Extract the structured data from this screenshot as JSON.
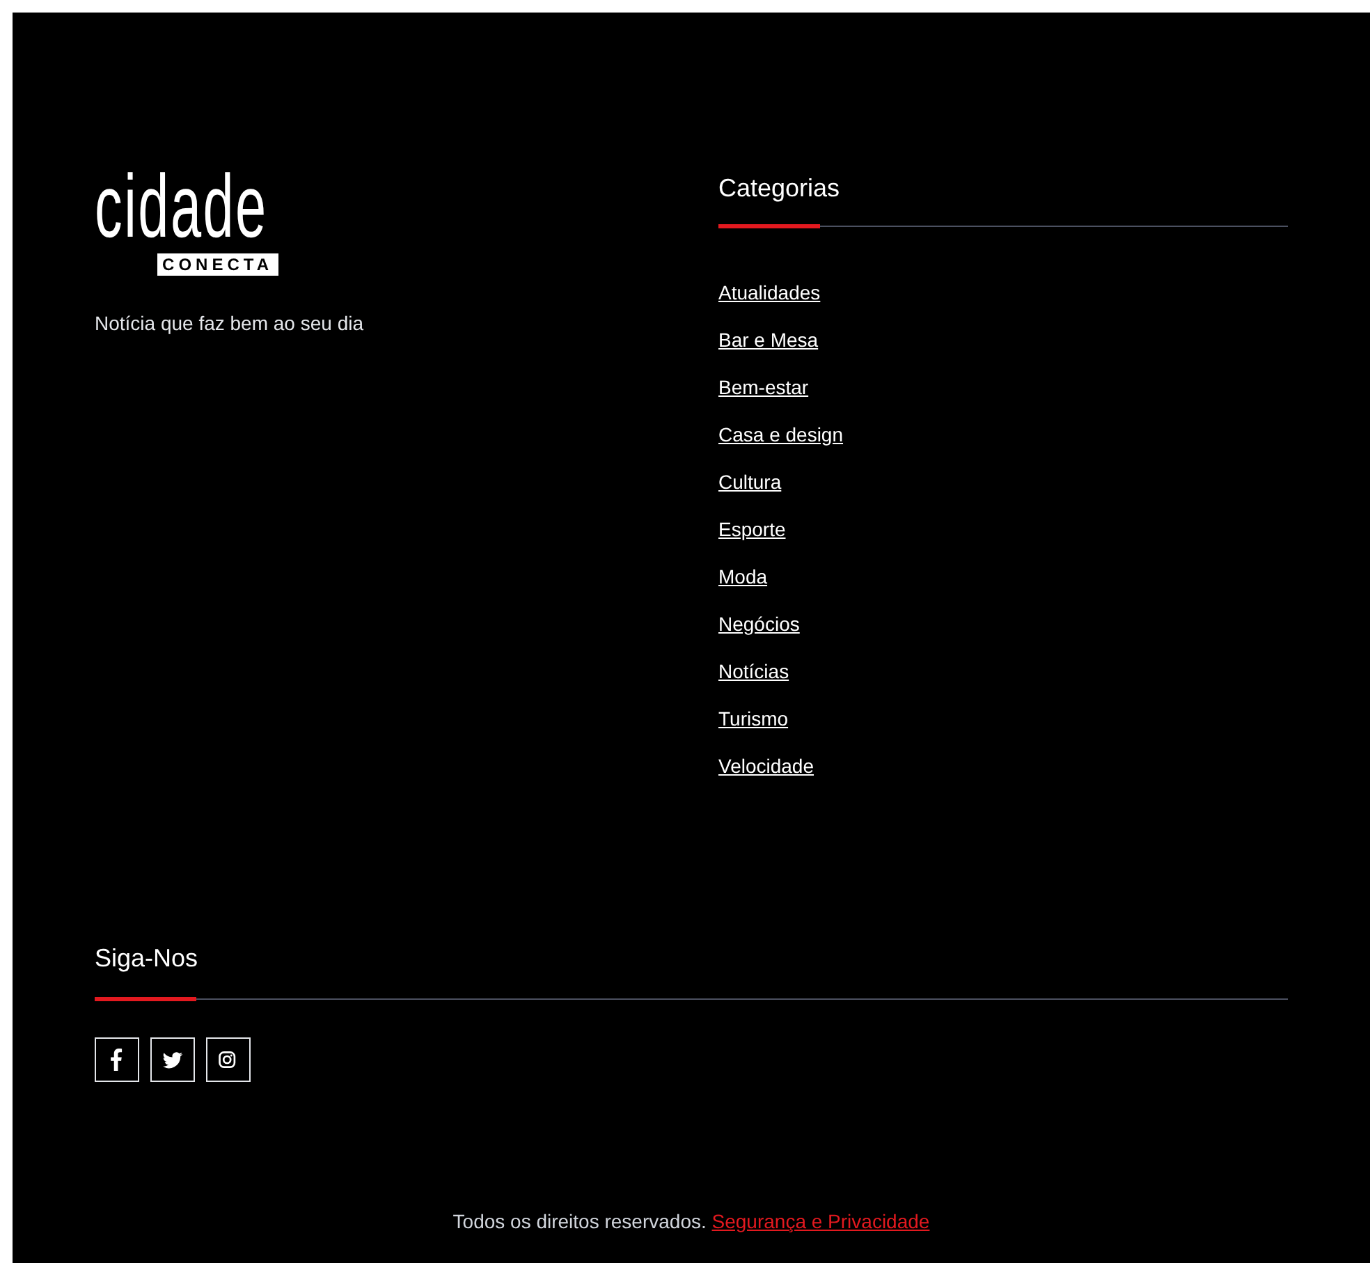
{
  "brand": {
    "logo_word": "cidade",
    "logo_tag": "CONECTA",
    "tagline": "Notícia que faz bem ao seu dia"
  },
  "categories": {
    "title": "Categorias",
    "links": [
      "Atualidades",
      "Bar e Mesa",
      "Bem-estar",
      "Casa e design",
      "Cultura",
      "Esporte",
      "Moda",
      "Negócios",
      "Notícias",
      "Turismo",
      "Velocidade"
    ]
  },
  "follow": {
    "title": "Siga-Nos",
    "socials": [
      {
        "kind": "facebook"
      },
      {
        "kind": "twitter"
      },
      {
        "kind": "instagram"
      }
    ]
  },
  "footer": {
    "text": "Todos os direitos reservados.",
    "link": "Segurança e Privacidade"
  }
}
